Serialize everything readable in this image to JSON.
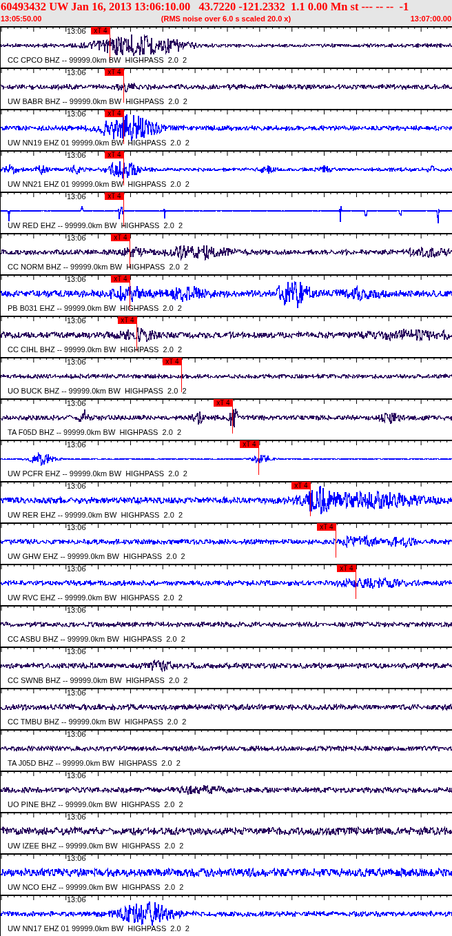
{
  "header": {
    "title": "60493432 UW Jan 16, 2013 13:06:10.00   43.7220 -121.2332  1.1 0.00 Mn st --- -- --  -1",
    "start_time": "13:05:50.00",
    "note": "(RMS noise over 6.0 s scaled 20.0 x)",
    "end_time": "13:07:00.00"
  },
  "traces": [
    {
      "station": "CC CPCO BHZ -- 99999.0km BW  HIGHPASS  2.0  2",
      "time_label": "13:06",
      "color": "#2a0a5e",
      "pick": "xT 4"
    },
    {
      "station": "UW BABR BHZ -- 99999.0km BW  HIGHPASS  2.0  2",
      "time_label": "13:06",
      "color": "#2a0a5e",
      "pick": "xT 4"
    },
    {
      "station": "UW NN19 EHZ 01 99999.0km BW  HIGHPASS  2.0  2",
      "time_label": "13:06",
      "color": "#0000ff",
      "pick": "xT 4"
    },
    {
      "station": "UW NN21 EHZ 01 99999.0km BW  HIGHPASS  2.0  2",
      "time_label": "13:06",
      "color": "#0000ff",
      "pick": "xT 4"
    },
    {
      "station": "UW RED EHZ -- 99999.0km BW  HIGHPASS  2.0  2",
      "time_label": "13:06",
      "color": "#0000ff",
      "pick": "xT 4"
    },
    {
      "station": "CC NORM BHZ -- 99999.0km BW  HIGHPASS  2.0  2",
      "time_label": "13:06",
      "color": "#2a0a5e",
      "pick": "xT 4"
    },
    {
      "station": "PB B031 EHZ -- 99999.0km BW  HIGHPASS  2.0  2",
      "time_label": "13:06",
      "color": "#0000ff",
      "pick": "xT 4"
    },
    {
      "station": "CC CIHL BHZ -- 99999.0km BW  HIGHPASS  2.0  2",
      "time_label": "13:06",
      "color": "#2a0a5e",
      "pick": "xT 4"
    },
    {
      "station": "UO BUCK BHZ -- 99999.0km BW  HIGHPASS  2.0  2",
      "time_label": "13:06",
      "color": "#2a0a5e",
      "pick": "xT 4"
    },
    {
      "station": "TA F05D BHZ -- 99999.0km BW  HIGHPASS  2.0  2",
      "time_label": "13:06",
      "color": "#2a0a5e",
      "pick": "xT 4"
    },
    {
      "station": "UW PCFR EHZ -- 99999.0km BW  HIGHPASS  2.0  2",
      "time_label": "13:06",
      "color": "#0000ff",
      "pick": "xT 4"
    },
    {
      "station": "UW RER EHZ -- 99999.0km BW  HIGHPASS  2.0  2",
      "time_label": "13:06",
      "color": "#0000ff",
      "pick": "xT 4"
    },
    {
      "station": "UW GHW EHZ -- 99999.0km BW  HIGHPASS  2.0  2",
      "time_label": "13:06",
      "color": "#0000ff",
      "pick": "xT 4"
    },
    {
      "station": "UW RVC EHZ -- 99999.0km BW  HIGHPASS  2.0  2",
      "time_label": "13:06",
      "color": "#0000ff",
      "pick": "xT 4"
    },
    {
      "station": "CC ASBU BHZ -- 99999.0km BW  HIGHPASS  2.0  2",
      "time_label": "13:06",
      "color": "#2a0a5e"
    },
    {
      "station": "CC SWNB BHZ -- 99999.0km BW  HIGHPASS  2.0  2",
      "time_label": "13:06",
      "color": "#2a0a5e"
    },
    {
      "station": "CC TMBU BHZ -- 99999.0km BW  HIGHPASS  2.0  2",
      "time_label": "13:06",
      "color": "#2a0a5e"
    },
    {
      "station": "TA J05D BHZ -- 99999.0km BW  HIGHPASS  2.0  2",
      "time_label": "13:06",
      "color": "#2a0a5e"
    },
    {
      "station": "UO PINE BHZ -- 99999.0km BW  HIGHPASS  2.0  2",
      "time_label": "13:06",
      "color": "#2a0a5e"
    },
    {
      "station": "UW IZEE BHZ -- 99999.0km BW  HIGHPASS  2.0  2",
      "time_label": "13:06",
      "color": "#2a0a5e"
    },
    {
      "station": "UW NCO EHZ -- 99999.0km BW  HIGHPASS  2.0  2",
      "time_label": "13:06",
      "color": "#0000ff"
    },
    {
      "station": "UW NN17 EHZ 01 99999.0km BW  HIGHPASS  2.0  2",
      "time_label": "13:06",
      "color": "#0000ff"
    }
  ]
}
